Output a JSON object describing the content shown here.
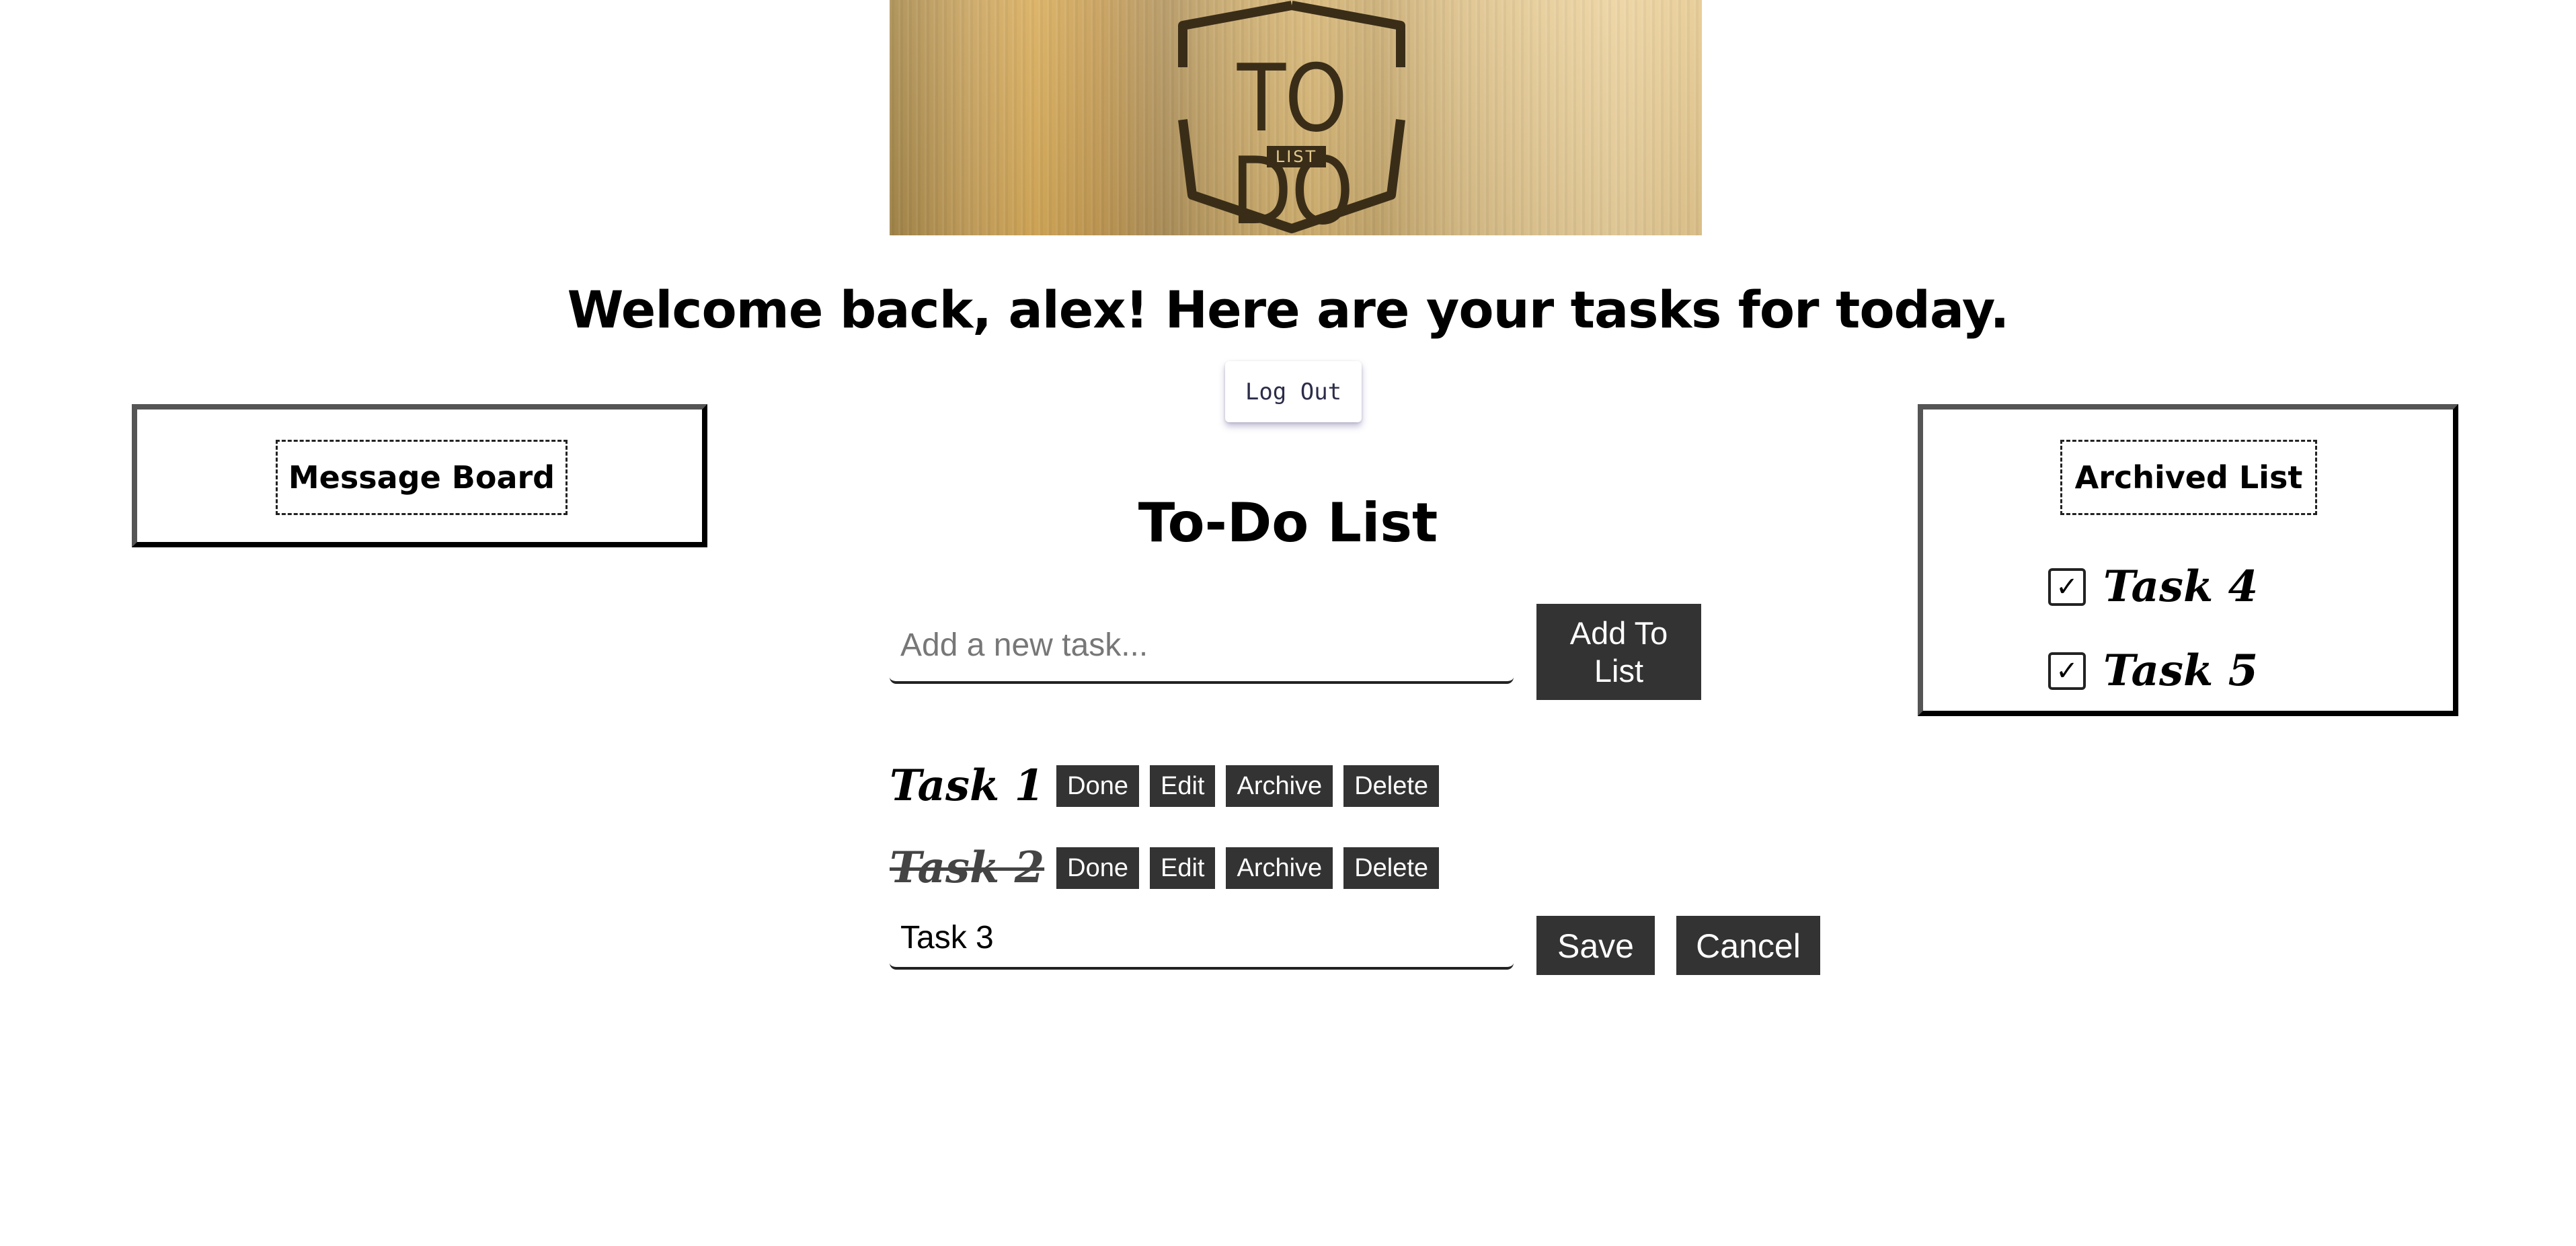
{
  "banner": {
    "logo_main": "TO DO",
    "logo_sub": "LIST"
  },
  "header": {
    "welcome_text": "Welcome back, alex! Here are your tasks for today.",
    "logout_label": "Log Out"
  },
  "message_board": {
    "title": "Message Board"
  },
  "archived": {
    "title": "Archived List",
    "check_glyph": "✓",
    "items": [
      {
        "label": "Task 4",
        "checked": true
      },
      {
        "label": "Task 5",
        "checked": true
      }
    ]
  },
  "todo": {
    "title": "To-Do List",
    "input_placeholder": "Add a new task...",
    "add_label": "Add To List",
    "tasks": [
      {
        "label": "Task 1",
        "done": false
      },
      {
        "label": "Task 2",
        "done": true
      }
    ],
    "task_buttons": {
      "done": "Done",
      "edit": "Edit",
      "archive": "Archive",
      "delete": "Delete"
    },
    "editing": {
      "value": "Task 3",
      "save_label": "Save",
      "cancel_label": "Cancel"
    }
  },
  "colors": {
    "button_bg": "#333333",
    "button_text": "#ffffff",
    "logo_dark": "#3a2d18"
  }
}
